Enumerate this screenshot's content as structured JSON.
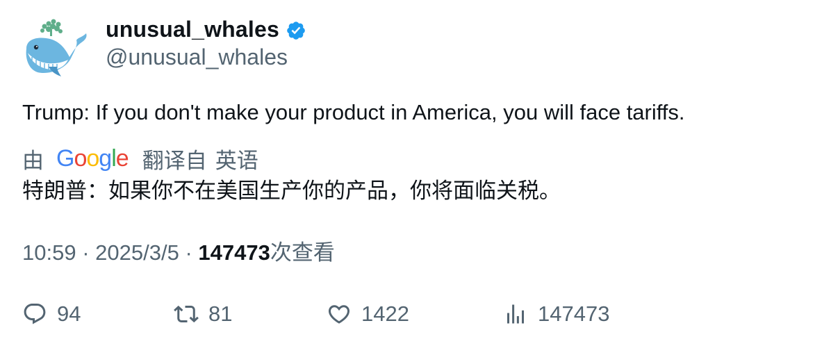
{
  "author": {
    "display_name": "unusual_whales",
    "handle": "@unusual_whales",
    "verified": true,
    "verified_icon": "verified-badge-icon",
    "avatar": "whale-logo"
  },
  "tweet": {
    "text": "Trump: If you don't make your product in America, you will face tariffs."
  },
  "translation": {
    "by_label": "由",
    "provider": "Google",
    "translated_from_label": "翻译自",
    "source_language": "英语",
    "translated_text": "特朗普：如果你不在美国生产你的产品，你将面临关税。"
  },
  "meta": {
    "time": "10:59",
    "separator": "·",
    "date": "2025/3/5",
    "views_count": "147473",
    "views_label": "次查看"
  },
  "actions": {
    "replies": "94",
    "retweets": "81",
    "likes": "1422",
    "views": "147473"
  },
  "colors": {
    "text_primary": "#0f1419",
    "text_secondary": "#536471",
    "verified_blue": "#1d9bf0",
    "google_blue": "#4285F4",
    "google_red": "#EA4335",
    "google_yellow": "#FBBC05",
    "google_green": "#34A853"
  }
}
